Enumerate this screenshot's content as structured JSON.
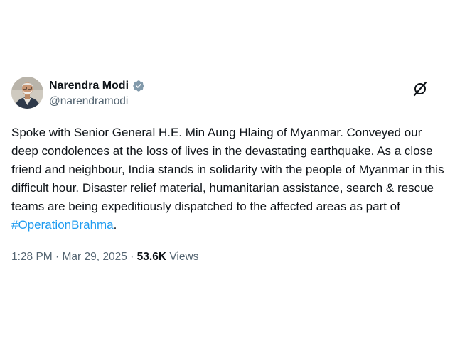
{
  "tweet": {
    "author": {
      "display_name": "Narendra Modi",
      "handle": "@narendramodi",
      "verified": true,
      "avatar_icon": "profile-photo"
    },
    "text_main": "Spoke with Senior General H.E. Min Aung Hlaing of Myanmar. Conveyed our deep condolences at the loss of lives in the devastating earthquake. As a close friend and neighbour, India stands in solidarity with the people of Myanmar in this difficult hour. Disaster relief material, humanitarian assistance, search & rescue teams are being expeditiously dispatched to the affected areas as part of ",
    "hashtag": "#OperationBrahma",
    "text_end": ".",
    "time": "1:28 PM",
    "separator": " · ",
    "date": "Mar 29, 2025",
    "views_count": "53.6K",
    "views_label": " Views",
    "grok_icon": "grok-icon"
  },
  "colors": {
    "text": "#0f1419",
    "secondary": "#536471",
    "hashtag": "#1d9bf0",
    "verified_badge": "#829aab"
  }
}
